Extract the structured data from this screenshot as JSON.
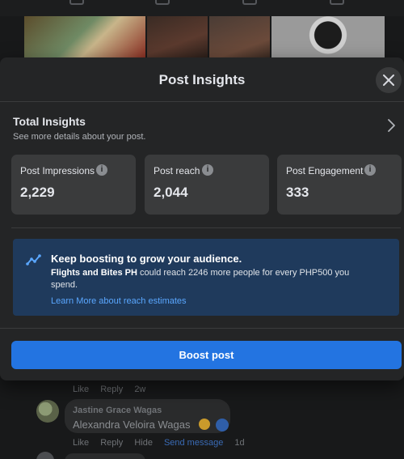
{
  "background": {
    "comment_meta_top": {
      "like": "Like",
      "reply": "Reply",
      "time": "2w"
    },
    "comment": {
      "author": "Jastine Grace Wagas",
      "text": "Alexandra Veloira Wagas"
    },
    "comment_meta": {
      "like": "Like",
      "reply": "Reply",
      "hide": "Hide",
      "send_message": "Send message",
      "time": "1d"
    }
  },
  "modal": {
    "title": "Post Insights",
    "close_icon": "close-icon",
    "total_insights": {
      "title": "Total Insights",
      "subtitle": "See more details about your post."
    },
    "stats": [
      {
        "label": "Post Impressions",
        "value": "2,229"
      },
      {
        "label": "Post reach",
        "value": "2,044"
      },
      {
        "label": "Post Engagement",
        "value": "333"
      }
    ],
    "boost_info": {
      "heading": "Keep boosting to grow your audience.",
      "page_name": "Flights and Bites PH",
      "text": " could reach 2246 more people for every PHP500 you spend.",
      "link": "Learn More about reach estimates"
    },
    "boost_button": "Boost post"
  },
  "colors": {
    "modal_bg": "#242526",
    "card_bg": "#3a3b3c",
    "accent": "#2374e1",
    "info_banner": "#1f3a5c",
    "link": "#5aa7ff"
  }
}
